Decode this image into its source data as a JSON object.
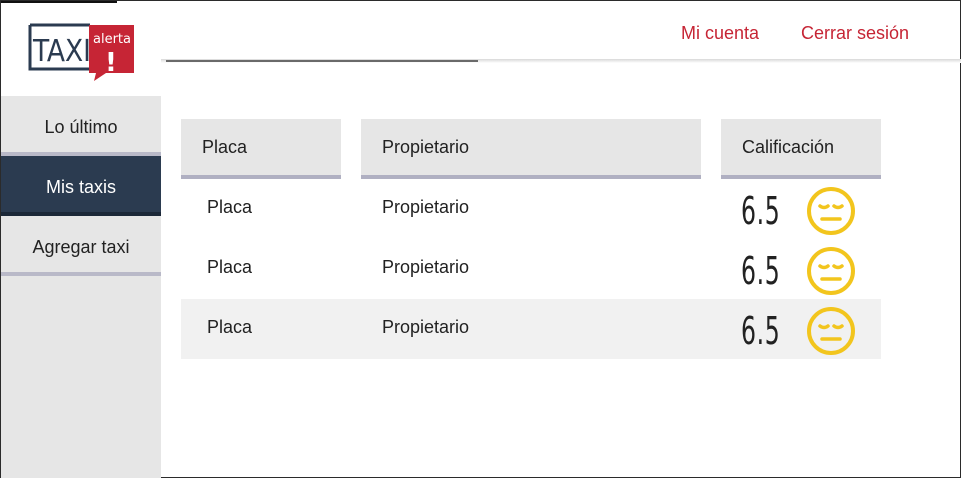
{
  "logo": {
    "taxi": "TAXI",
    "alerta": "alerta",
    "mark": "!"
  },
  "header": {
    "account_link": "Mi cuenta",
    "logout_link": "Cerrar sesión"
  },
  "sidebar": {
    "items": [
      {
        "label": "Lo último",
        "active": false
      },
      {
        "label": "Mis taxis",
        "active": true
      },
      {
        "label": "Agregar taxi",
        "active": false
      }
    ]
  },
  "table": {
    "headers": {
      "plate": "Placa",
      "owner": "Propietario",
      "rating": "Calificación"
    },
    "rows": [
      {
        "plate": "Placa",
        "owner": "Propietario",
        "rating": "6.5",
        "icon": "neutral-face-icon"
      },
      {
        "plate": "Placa",
        "owner": "Propietario",
        "rating": "6.5",
        "icon": "neutral-face-icon"
      },
      {
        "plate": "Placa",
        "owner": "Propietario",
        "rating": "6.5",
        "icon": "neutral-face-icon"
      }
    ]
  },
  "colors": {
    "accent_red": "#c62535",
    "sidebar_active": "#2b3b50",
    "face_yellow": "#f2c51d"
  }
}
